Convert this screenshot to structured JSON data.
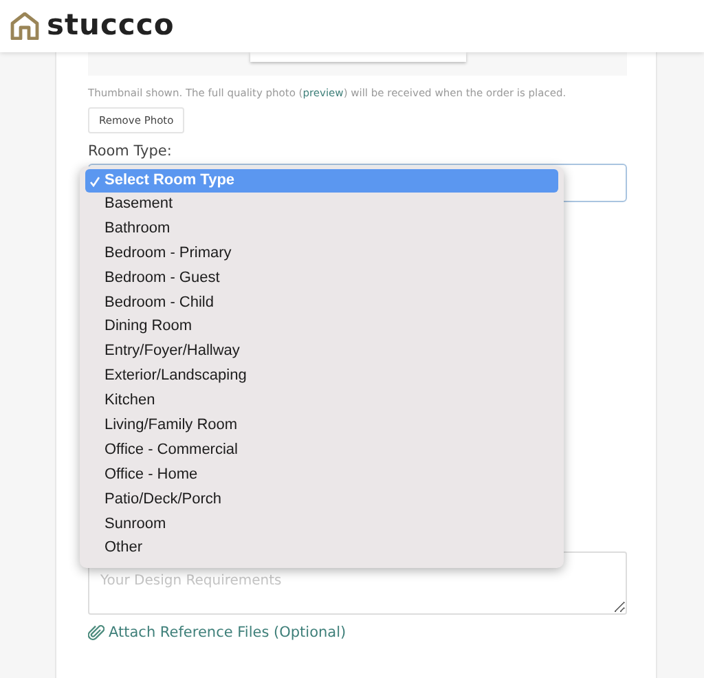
{
  "header": {
    "logo_text": "stuccco"
  },
  "photo_note": {
    "before": "Thumbnail shown. The full quality photo (",
    "link": "preview",
    "after": ") will be received when the order is placed."
  },
  "remove_button": "Remove Photo",
  "room_type": {
    "label": "Room Type:",
    "options": [
      {
        "label": "Select Room Type",
        "selected": true
      },
      {
        "label": "Basement",
        "selected": false
      },
      {
        "label": "Bathroom",
        "selected": false
      },
      {
        "label": "Bedroom - Primary",
        "selected": false
      },
      {
        "label": "Bedroom - Guest",
        "selected": false
      },
      {
        "label": "Bedroom - Child",
        "selected": false
      },
      {
        "label": "Dining Room",
        "selected": false
      },
      {
        "label": "Entry/Foyer/Hallway",
        "selected": false
      },
      {
        "label": "Exterior/Landscaping",
        "selected": false
      },
      {
        "label": "Kitchen",
        "selected": false
      },
      {
        "label": "Living/Family Room",
        "selected": false
      },
      {
        "label": "Office - Commercial",
        "selected": false
      },
      {
        "label": "Office - Home",
        "selected": false
      },
      {
        "label": "Patio/Deck/Porch",
        "selected": false
      },
      {
        "label": "Sunroom",
        "selected": false
      },
      {
        "label": "Other",
        "selected": false
      }
    ]
  },
  "requirements": {
    "placeholder": "Your Design Requirements"
  },
  "attach_link": "Attach Reference Files (Optional)"
}
